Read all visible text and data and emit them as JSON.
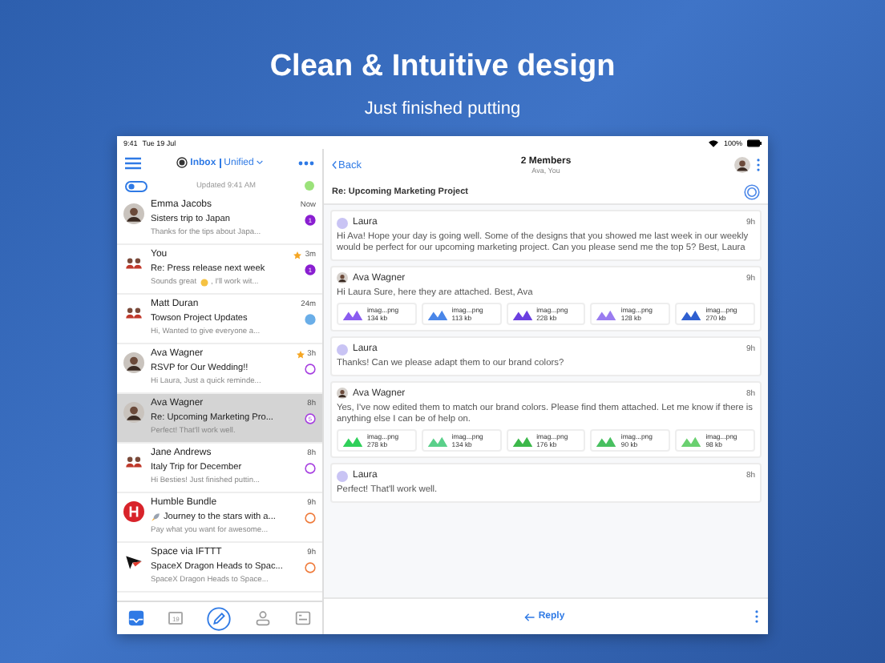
{
  "hero": {
    "title": "Clean & Intuitive design",
    "subtitle": "Just finished putting"
  },
  "status_bar": {
    "time": "9:41",
    "date": "Tue 19 Jul",
    "battery": "100%"
  },
  "list_header": {
    "inbox": "Inbox",
    "account": "Unified",
    "updated": "Updated 9:41 AM",
    "toggle_on": true
  },
  "messages": [
    {
      "sender": "Emma Jacobs",
      "subject": "Sisters trip to Japan",
      "preview": "Thanks for the tips about Japa...",
      "time": "Now",
      "starred": false,
      "selected": false,
      "badge": "1",
      "filled": true,
      "color": "#8a1fd1",
      "avatar": {
        "kind": "photo"
      }
    },
    {
      "sender": "You",
      "subject": "Re: Press release next week",
      "preview": "Sounds great",
      "preview_tail": ", I'll work wit...",
      "time": "3m",
      "starred": true,
      "selected": false,
      "badge": "1",
      "filled": true,
      "color": "#8a1fd1",
      "avatar": {
        "kind": "group"
      }
    },
    {
      "sender": "Matt Duran",
      "subject": "Towson Project Updates",
      "preview": "Hi, Wanted to give everyone a...",
      "time": "24m",
      "starred": false,
      "selected": false,
      "filled": true,
      "color": "#6aaee8",
      "avatar": {
        "kind": "group"
      }
    },
    {
      "sender": "Ava Wagner",
      "subject": "RSVP for Our Wedding!!",
      "preview": "Hi Laura, Just a quick reminde...",
      "time": "3h",
      "starred": true,
      "selected": false,
      "filled": false,
      "color": "#a63ee0",
      "avatar": {
        "kind": "photo"
      }
    },
    {
      "sender": "Ava Wagner",
      "subject": "Re: Upcoming Marketing Pro...",
      "preview": "Perfect! That'll work well.",
      "time": "8h",
      "starred": false,
      "selected": true,
      "badge": "5",
      "filled": false,
      "color": "#a63ee0",
      "avatar": {
        "kind": "photo"
      }
    },
    {
      "sender": "Jane Andrews",
      "subject": "Italy Trip for December",
      "preview": "Hi Besties! Just finished puttin...",
      "time": "8h",
      "starred": false,
      "selected": false,
      "filled": false,
      "color": "#a63ee0",
      "avatar": {
        "kind": "group"
      }
    },
    {
      "sender": "Humble Bundle",
      "subject": "Journey to the stars with a...",
      "subject_icon": {
        "kind": "rocket"
      },
      "preview": "Pay what you want for awesome...",
      "time": "9h",
      "starred": false,
      "selected": false,
      "filled": false,
      "color": "#ef7a3a",
      "avatar": {
        "kind": "logo"
      }
    },
    {
      "sender": "Space via IFTTT",
      "subject": "SpaceX Dragon Heads to Spac...",
      "preview": "SpaceX Dragon Heads to Space...",
      "time": "9h",
      "starred": false,
      "selected": false,
      "filled": false,
      "color": "#ef7a3a",
      "avatar": {
        "kind": "arrow"
      }
    }
  ],
  "tabs": [
    {
      "kind": "inbox",
      "selected": true
    },
    {
      "kind": "calendar",
      "label": "19",
      "selected": false
    },
    {
      "kind": "compose",
      "selected": false
    },
    {
      "kind": "contacts",
      "selected": false
    },
    {
      "kind": "files",
      "selected": false
    }
  ],
  "thread_header": {
    "back": "Back",
    "title": "2 Members",
    "members": "Ava, You",
    "subject": "Re: Upcoming Marketing Project"
  },
  "thread": [
    {
      "sender": "Laura",
      "avatar": {
        "kind": "initials"
      },
      "time": "9h",
      "body": "Hi Ava! Hope your day is going well. Some of the designs that you showed me last week in our weekly would be perfect for our upcoming marketing project. Can you please send me the top 5? Best, Laura"
    },
    {
      "sender": "Ava Wagner",
      "avatar": {
        "kind": "photo"
      },
      "time": "9h",
      "body": "Hi Laura Sure, here they are attached. Best, Ava",
      "attachments": [
        {
          "name": "imag...png",
          "size": "134 kb",
          "color": "#8a5cf0"
        },
        {
          "name": "imag...png",
          "size": "113 kb",
          "color": "#4a86e8"
        },
        {
          "name": "imag...png",
          "size": "228 kb",
          "color": "#6b3fe0"
        },
        {
          "name": "imag...png",
          "size": "128 kb",
          "color": "#9a7cf0"
        },
        {
          "name": "imag...png",
          "size": "270 kb",
          "color": "#2f5fd0"
        }
      ]
    },
    {
      "sender": "Laura",
      "avatar": {
        "kind": "initials"
      },
      "time": "9h",
      "body": "Thanks! Can we please adapt them to our brand colors?"
    },
    {
      "sender": "Ava Wagner",
      "avatar": {
        "kind": "photo"
      },
      "time": "8h",
      "body": "Yes, I've now edited them to match our brand colors. Please find them attached. Let me know if there is anything else I can be of help on.",
      "attachments": [
        {
          "name": "imag...png",
          "size": "278 kb",
          "color": "#2fd05a"
        },
        {
          "name": "imag...png",
          "size": "134 kb",
          "color": "#5ad08a"
        },
        {
          "name": "imag...png",
          "size": "176 kb",
          "color": "#3cb84a"
        },
        {
          "name": "imag...png",
          "size": "90 kb",
          "color": "#48c060"
        },
        {
          "name": "imag...png",
          "size": "98 kb",
          "color": "#6ad070"
        }
      ]
    },
    {
      "sender": "Laura",
      "avatar": {
        "kind": "initials"
      },
      "time": "8h",
      "body": "Perfect! That'll work well."
    }
  ],
  "reply": {
    "label": "Reply"
  }
}
